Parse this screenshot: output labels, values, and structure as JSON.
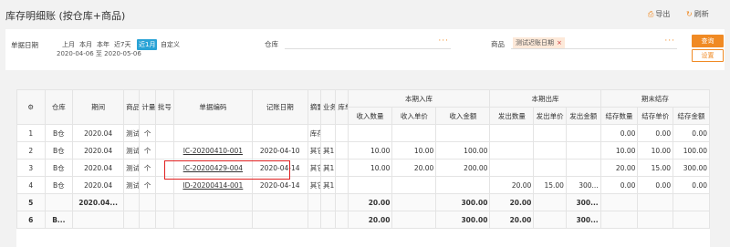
{
  "page": {
    "title": "库存明细账 (按仓库+商品)"
  },
  "toolbar": {
    "export_label": "导出",
    "refresh_label": "刷新"
  },
  "filter": {
    "doc_date_label": "单据日期",
    "quick_dates": [
      "上月",
      "本月",
      "本年",
      "近7天",
      "近1月",
      "自定义"
    ],
    "selected_quick": "近1月",
    "date_range": {
      "from": "2020-04-06",
      "sep": "至",
      "to": "2020-05-06"
    },
    "warehouse_label": "仓库",
    "warehouse_value": "",
    "product_label": "商品",
    "product_tag": "测试迟账日期",
    "query_button": "查询",
    "settings_button": "设置"
  },
  "table": {
    "headers_top": [
      "仓库",
      "期间",
      "商品",
      "计量单位",
      "批号",
      "单据编码",
      "记账日期",
      "摘要",
      "业务类型",
      "库单价"
    ],
    "group_headers": [
      "本期入库",
      "本期出库",
      "期末结存"
    ],
    "sub_headers": [
      "收入数量",
      "收入单价",
      "收入金额",
      "发出数量",
      "发出单价",
      "发出金额",
      "结存数量",
      "结存单价",
      "结存金额"
    ],
    "rows": [
      {
        "no": "1",
        "wh": "B仓",
        "period": "2020.04",
        "prod": "测试",
        "unit": "个",
        "batch": "",
        "code": "",
        "date": "",
        "abstract": "库存",
        "type": "",
        "uprice": "",
        "in_qty": "",
        "in_price": "",
        "in_amt": "",
        "out_qty": "",
        "out_price": "",
        "out_amt": "",
        "bal_qty": "0.00",
        "bal_price": "0.00",
        "bal_amt": "0.00"
      },
      {
        "no": "2",
        "wh": "B仓",
        "period": "2020.04",
        "prod": "测试",
        "unit": "个",
        "batch": "",
        "code": "IC-20200410-001",
        "date": "2020-04-10",
        "abstract": "其它",
        "type": "其1",
        "uprice": "",
        "in_qty": "10.00",
        "in_price": "10.00",
        "in_amt": "100.00",
        "out_qty": "",
        "out_price": "",
        "out_amt": "",
        "bal_qty": "10.00",
        "bal_price": "10.00",
        "bal_amt": "100.00"
      },
      {
        "no": "3",
        "wh": "B仓",
        "period": "2020.04",
        "prod": "测试",
        "unit": "个",
        "batch": "",
        "code": "IC-20200429-004",
        "date": "2020-04-14",
        "abstract": "其它",
        "type": "其1",
        "uprice": "",
        "in_qty": "10.00",
        "in_price": "20.00",
        "in_amt": "200.00",
        "out_qty": "",
        "out_price": "",
        "out_amt": "",
        "bal_qty": "20.00",
        "bal_price": "15.00",
        "bal_amt": "300.00"
      },
      {
        "no": "4",
        "wh": "B仓",
        "period": "2020.04",
        "prod": "测试",
        "unit": "个",
        "batch": "",
        "code": "ID-20200414-001",
        "date": "2020-04-14",
        "abstract": "其它",
        "type": "其1",
        "uprice": "",
        "in_qty": "",
        "in_price": "",
        "in_amt": "",
        "out_qty": "20.00",
        "out_price": "15.00",
        "out_amt": "300...",
        "bal_qty": "0.00",
        "bal_price": "0.00",
        "bal_amt": "0.00"
      }
    ],
    "sum_rows": [
      {
        "no": "5",
        "wh": "",
        "period": "2020.04...",
        "in_qty": "20.00",
        "in_amt": "300.00",
        "out_qty": "20.00",
        "out_amt": "300..."
      },
      {
        "no": "6",
        "wh": "B...",
        "period": "",
        "in_qty": "20.00",
        "in_amt": "300.00",
        "out_qty": "20.00",
        "out_amt": "300..."
      }
    ]
  }
}
